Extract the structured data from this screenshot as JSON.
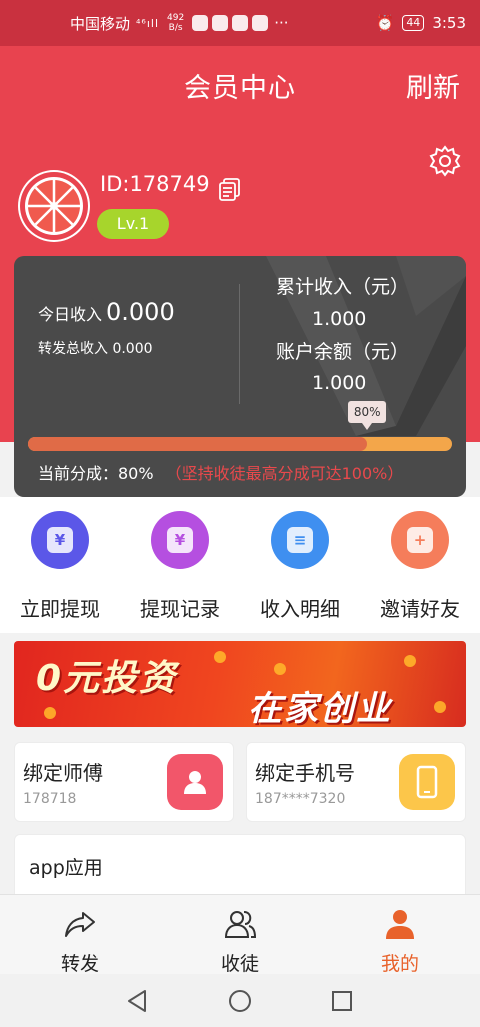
{
  "status_bar": {
    "carrier": "中国移动",
    "network": "⁴⁶ıll",
    "speed_value": "492",
    "speed_unit": "B/s",
    "overflow": "···",
    "battery": "44",
    "time": "3:53"
  },
  "header": {
    "title": "会员中心",
    "refresh_label": "刷新"
  },
  "profile": {
    "id_text": "ID:178749",
    "level": "Lv.1"
  },
  "income_card": {
    "today_label": "今日收入",
    "today_value": "0.000",
    "forward_total": "转发总收入 0.000",
    "cumulative_label": "累计收入（元）",
    "cumulative_value": "1.000",
    "balance_label": "账户余额（元）",
    "balance_value": "1.000",
    "share_percent_label": "80%",
    "share_fraction": 0.8,
    "current_share_label": "当前分成：80%",
    "share_hint": "（坚持收徒最高分成可达100%）"
  },
  "actions": [
    {
      "label": "立即提现",
      "icon": "wallet-icon",
      "color": "#5b57e8",
      "glyph": "¥"
    },
    {
      "label": "提现记录",
      "icon": "receipt-icon",
      "color": "#b54fe0",
      "glyph": "¥"
    },
    {
      "label": "收入明细",
      "icon": "document-icon",
      "color": "#3f8ff0",
      "glyph": "≡"
    },
    {
      "label": "邀请好友",
      "icon": "add-friend-icon",
      "color": "#f57d5b",
      "glyph": "+"
    }
  ],
  "banner": {
    "line1": "0元投资",
    "line2": "在家创业"
  },
  "bind": {
    "master_label": "绑定师傅",
    "master_value": "178718",
    "phone_label": "绑定手机号",
    "phone_value": "187****7320"
  },
  "apps_section": {
    "title": "app应用"
  },
  "tabs": [
    {
      "label": "转发",
      "icon": "share-icon"
    },
    {
      "label": "收徒",
      "icon": "disciples-icon"
    },
    {
      "label": "我的",
      "icon": "profile-icon"
    }
  ],
  "colors": {
    "brand_red": "#e8434f",
    "status_red": "#c9313f",
    "card_dark": "#4a4a4a",
    "active_tab": "#e8622b",
    "level_green": "#a7d52c"
  }
}
